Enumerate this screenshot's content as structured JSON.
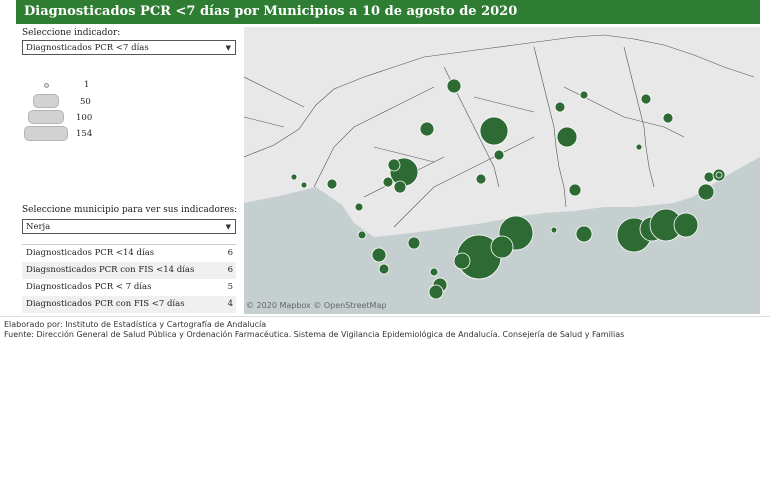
{
  "title": "Diagnosticados PCR <7 días por Municipios a 10 de agosto de 2020",
  "indicator": {
    "label": "Seleccione indicador:",
    "selected": "Diagnosticados PCR <7 días"
  },
  "size_legend": {
    "items": [
      "1",
      "50",
      "100",
      "154"
    ]
  },
  "municipality": {
    "label": "Seleccione municipio para ver sus indicadores:",
    "selected": "Nerja"
  },
  "indicators": [
    {
      "name": "Diagnosticados PCR <14 días",
      "value": "6"
    },
    {
      "name": "Diagsnosticados PCR con FIS <14 días",
      "value": "6"
    },
    {
      "name": "Diagnosticados PCR < 7 días",
      "value": "5"
    },
    {
      "name": "Diagnosticados PCR con FIS <7 días",
      "value": "4"
    }
  ],
  "map": {
    "attribution": "© 2020 Mapbox © OpenStreetMap",
    "colors": {
      "land": "#e8e8e8",
      "sea": "#c5cfcf",
      "bubble": "#2e6b34",
      "border": "#3a3a3a"
    }
  },
  "footer": {
    "elaborado": "Elaborado por: Instituto de Estadística y Cartografía de Andalucía",
    "fuente": "Fuente: Dirección General de Salud Pública y Ordenación Farmacéutica. Sistema de Vigilancia Epidemiológica de Andalucía. Consejería de Salud y Familias"
  }
}
